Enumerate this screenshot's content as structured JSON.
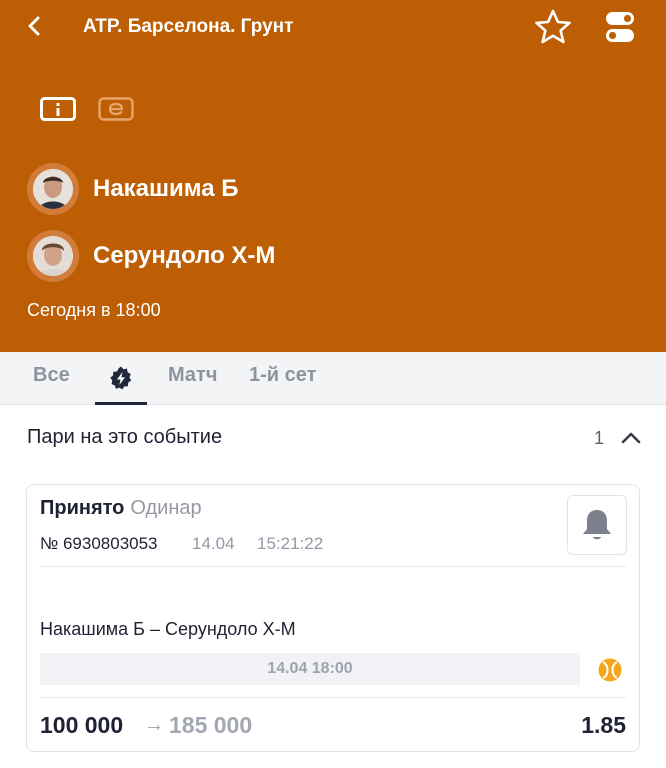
{
  "header": {
    "title": "ATP. Барселона. Грунт",
    "back_icon": "chevron-left-icon",
    "favorite_icon": "star-icon",
    "settings_icon": "toggle-icon",
    "info_tab_icon": "info-icon",
    "e_tab_icon": "e-icon",
    "bg_color": "#bd5e04"
  },
  "players": [
    {
      "name": "Накашима Б"
    },
    {
      "name": "Серундоло Х-М"
    }
  ],
  "start_time": "Сегодня в 18:00",
  "tabs": [
    {
      "label": "Все"
    },
    {
      "label": "",
      "icon": "lightning-icon",
      "active": true
    },
    {
      "label": "Матч"
    },
    {
      "label": "1-й сет"
    }
  ],
  "bets_section": {
    "title": "Пари на это событие",
    "count": "1",
    "collapse_icon": "chevron-up-icon"
  },
  "bet": {
    "status": "Принято",
    "type": "Одинар",
    "number": "№ 6930803053",
    "date": "14.04",
    "time": "15:21:22",
    "bell_icon": "bell-icon",
    "event": "Накашима Б – Серундоло Х-М",
    "event_date": "14.04 18:00",
    "sport_icon": "tennis-ball-icon",
    "stake": "100 000",
    "arrow": "→",
    "payout": "185 000",
    "coefficient": "1.85"
  }
}
